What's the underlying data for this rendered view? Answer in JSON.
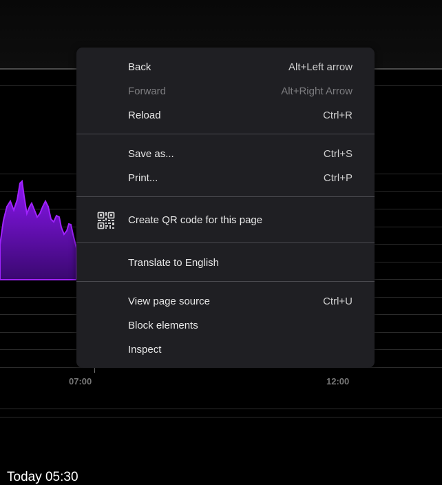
{
  "menu": {
    "back": {
      "label": "Back",
      "shortcut": "Alt+Left arrow"
    },
    "forward": {
      "label": "Forward",
      "shortcut": "Alt+Right Arrow"
    },
    "reload": {
      "label": "Reload",
      "shortcut": "Ctrl+R"
    },
    "save_as": {
      "label": "Save as...",
      "shortcut": "Ctrl+S"
    },
    "print": {
      "label": "Print...",
      "shortcut": "Ctrl+P"
    },
    "qr_code": {
      "label": "Create QR code for this page",
      "icon": "qr-code-icon"
    },
    "translate": {
      "label": "Translate to English"
    },
    "view_source": {
      "label": "View page source",
      "shortcut": "Ctrl+U"
    },
    "block": {
      "label": "Block elements"
    },
    "inspect": {
      "label": "Inspect"
    }
  },
  "chart": {
    "x_labels": [
      "07:00",
      "12:00"
    ],
    "area_color": "#7a12d4"
  },
  "footer": {
    "today": "Today 05:30"
  }
}
